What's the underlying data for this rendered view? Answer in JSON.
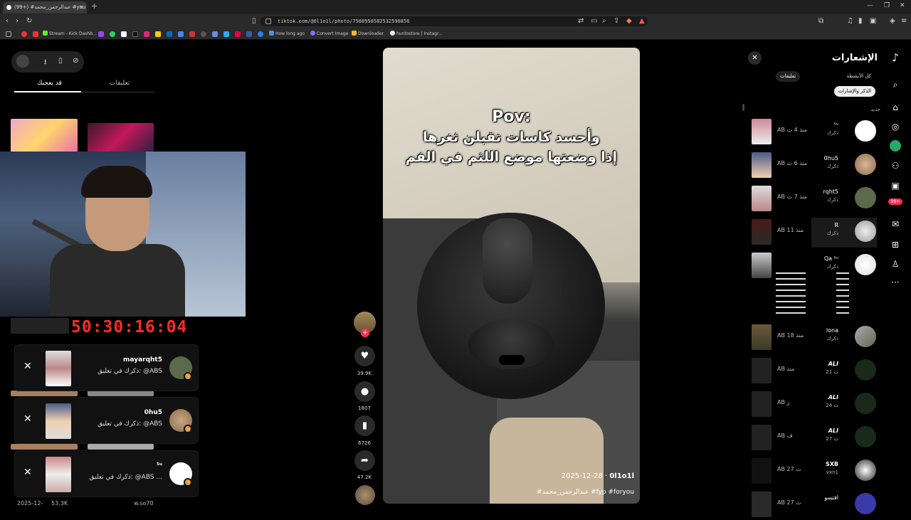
{
  "browser": {
    "tab_title": "(99+) #عبدالرحمن_محمد #you",
    "url": "tiktok.com/@0l1o1l/photo/7588958582532598856",
    "bookmarks": [
      "Stream - Kick Dashb...",
      "How long ago",
      "Convert Image",
      "Downloader",
      "huntostore | Instagr..."
    ]
  },
  "left_panel": {
    "tabs": [
      "تعليقات",
      "قد يعجبك"
    ],
    "timer": "50:30:16:04",
    "notifications": [
      {
        "user": "mayarqht5",
        "text": "ذكرك في تعليق: @ABS"
      },
      {
        "user": "0hu5",
        "text": "ذكرك في تعليق: @ABS"
      },
      {
        "user": "⁵ᵘ",
        "text": "ذكرك في تعليق: @ABS ..."
      }
    ],
    "bottom_meta": {
      "date": "2025-12-",
      "likes": "53.3K",
      "user": "w.so70"
    }
  },
  "video": {
    "caption_line1": "Pov:",
    "caption_line2": "وأحسد كاسات تقبلن ثغرها",
    "caption_line3": "إذا وضعتها موضع اللثم في الفم",
    "author": "0l1o1l",
    "date": "2025-12-28",
    "tags": "#عبدالرحمن_محمد #fyp #foryou"
  },
  "actions": {
    "likes": "39.9K",
    "comments": "1807",
    "saves": "6726",
    "shares": "47.2K"
  },
  "notifications_panel": {
    "title": "الإشعارات",
    "filters": [
      "كل الأنشطة",
      "تعليقات",
      "الذكر والإشارات"
    ],
    "section_new": "جديد",
    "rows": [
      {
        "name": "⁵ᵘ",
        "sub": "ذكرك",
        "time": "AB منذ 4 ث"
      },
      {
        "name": "0hu5",
        "sub": "ذكرك",
        "time": "AB منذ 6 ث"
      },
      {
        "name": "rqht5",
        "sub": "ذكرك",
        "time": "AB منذ 7 ث"
      },
      {
        "name": "R",
        "sub": "ذكرك",
        "time": "AB منذ 11"
      },
      {
        "name": "Qa ⁵ᵘ",
        "sub": "ذكرك",
        "time": ""
      },
      {
        "name": "lona",
        "sub": "ذكرك",
        "time": "AB منذ 18"
      },
      {
        "name": "ALI",
        "sub": "21 ث",
        "time": "AB منذ"
      },
      {
        "name": "ALI",
        "sub": "24 ث",
        "time": "AB ز"
      },
      {
        "name": "ALI",
        "sub": "27 ث",
        "time": "AB ف"
      },
      {
        "name": "SXB",
        "sub": "vxn1",
        "time": "AB 27 ث"
      },
      {
        "name": "افتسو",
        "sub": "",
        "time": "AB 27 ث"
      }
    ],
    "badge": "99+"
  }
}
